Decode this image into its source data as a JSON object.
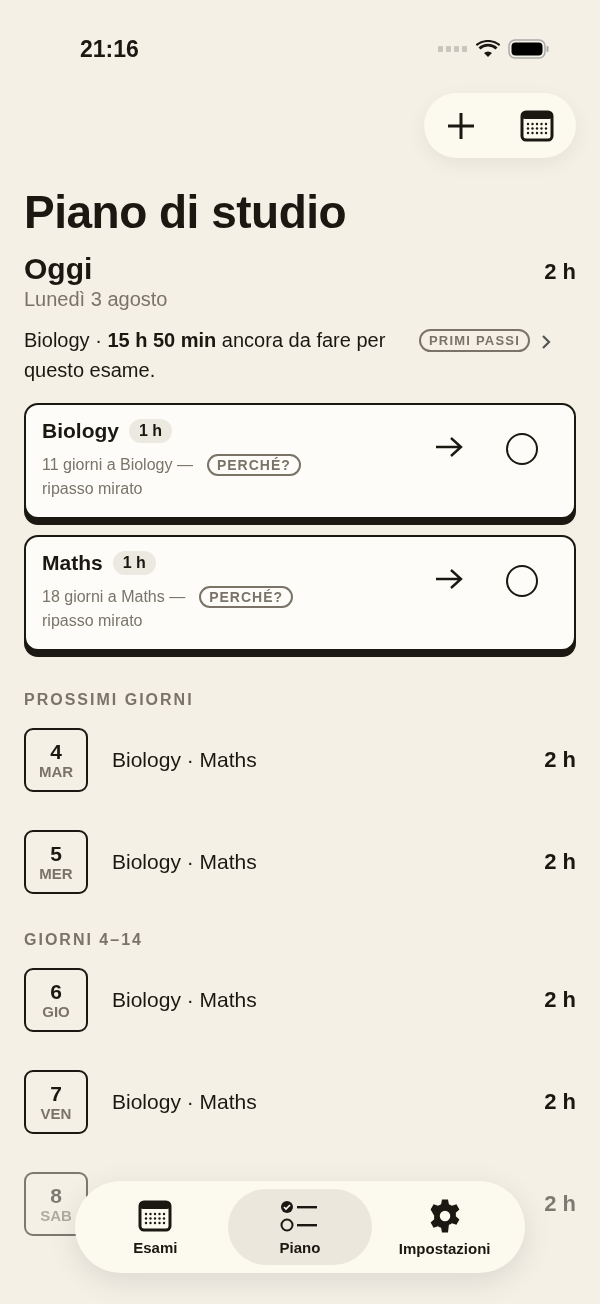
{
  "status_bar": {
    "time": "21:16"
  },
  "header": {
    "title": "Piano di studio"
  },
  "today": {
    "title": "Oggi",
    "total": "2 h",
    "date": "Lunedì 3 agosto",
    "summary": "Biology · **15 h 50 min** ancora da fare per questo esame.",
    "badge": "PRIMI PASSI"
  },
  "sessions": [
    {
      "subject": "Biology",
      "duration": "1 h",
      "note": "11 giorni a Biology —",
      "why": "PERCHÉ?",
      "note_end": "ripasso mirato",
      "done": false
    },
    {
      "subject": "Maths",
      "duration": "1 h",
      "note": "18 giorni a Maths —",
      "why": "PERCHÉ?",
      "note_end": "ripasso mirato",
      "done": false
    }
  ],
  "sections": [
    {
      "title": "PROSSIMI GIORNI",
      "days": [
        {
          "day": "4",
          "weekday": "MAR",
          "subjects": "Biology · Maths",
          "total": "2 h",
          "dimmed": false
        },
        {
          "day": "5",
          "weekday": "MER",
          "subjects": "Biology · Maths",
          "total": "2 h",
          "dimmed": false
        }
      ]
    },
    {
      "title": "GIORNI 4–14",
      "days": [
        {
          "day": "6",
          "weekday": "GIO",
          "subjects": "Biology · Maths",
          "total": "2 h",
          "dimmed": false
        },
        {
          "day": "7",
          "weekday": "VEN",
          "subjects": "Biology · Maths",
          "total": "2 h",
          "dimmed": false
        },
        {
          "day": "8",
          "weekday": "SAB",
          "total": "2 h",
          "dimmed": true
        }
      ]
    }
  ],
  "tab_bar": [
    {
      "label": "Esami",
      "kind": "calendar",
      "selected": false
    },
    {
      "label": "Piano",
      "kind": "checklist",
      "selected": true
    },
    {
      "label": "Impostazioni",
      "kind": "settings",
      "selected": false
    }
  ]
}
